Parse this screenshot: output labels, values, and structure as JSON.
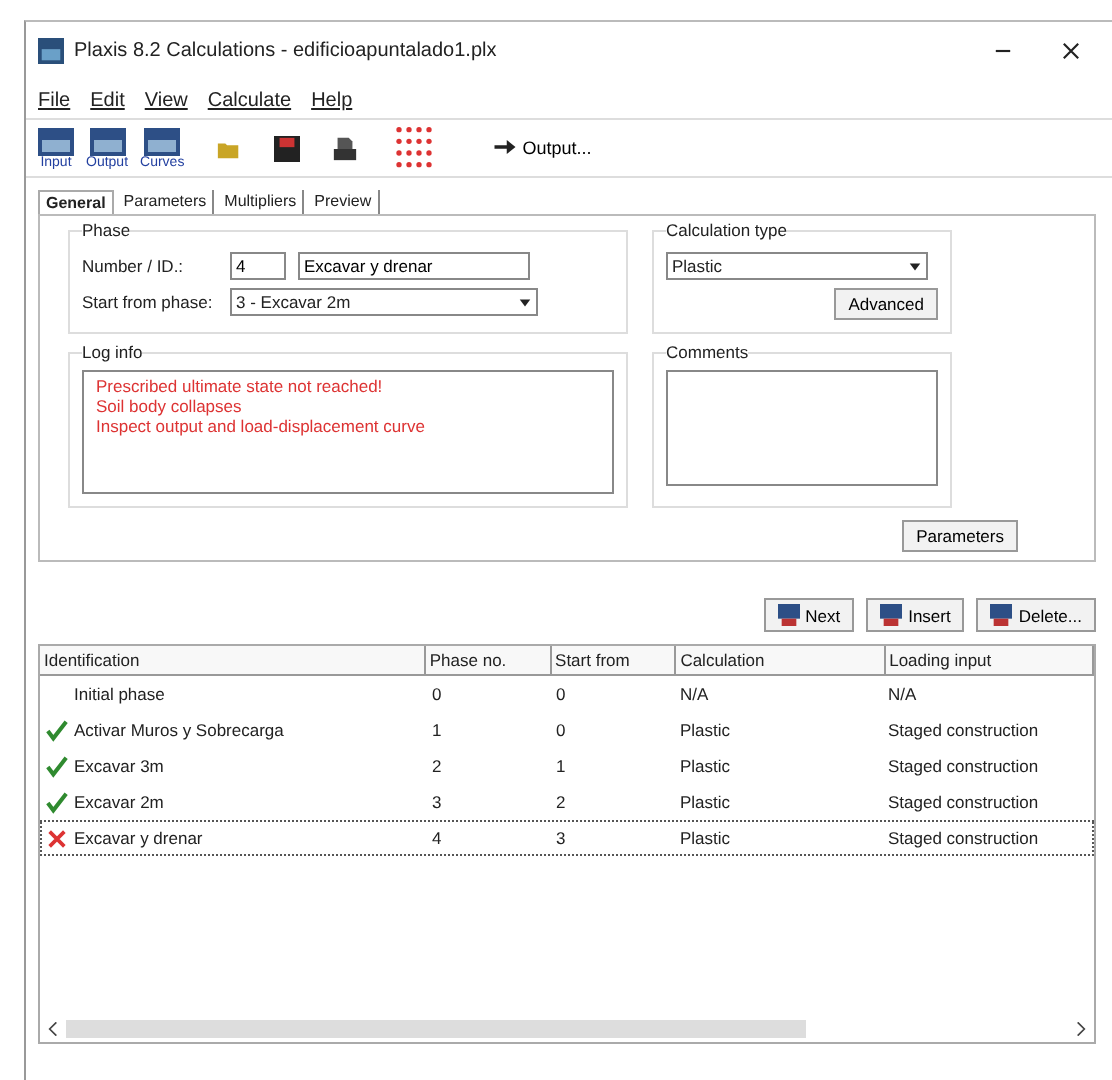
{
  "window": {
    "title": "Plaxis 8.2 Calculations - edificioapuntalado1.plx"
  },
  "menu": [
    "File",
    "Edit",
    "View",
    "Calculate",
    "Help"
  ],
  "toolbar": {
    "buttons": [
      {
        "kind": "module",
        "label": "Input"
      },
      {
        "kind": "module",
        "label": "Output"
      },
      {
        "kind": "module",
        "label": "Curves"
      },
      {
        "kind": "open"
      },
      {
        "kind": "save"
      },
      {
        "kind": "print"
      },
      {
        "kind": "points"
      }
    ],
    "output": "Output..."
  },
  "tabs": [
    {
      "label": "General",
      "selected": true
    },
    {
      "label": "Parameters",
      "selected": false
    },
    {
      "label": "Multipliers",
      "selected": false
    },
    {
      "label": "Preview",
      "selected": false
    }
  ],
  "phase": {
    "title": "Phase",
    "number_label": "Number / ID.:",
    "number": "4",
    "id": "Excavar y drenar",
    "start_label": "Start from phase:",
    "start": "3 - Excavar 2m"
  },
  "calculation_type": {
    "title": "Calculation type",
    "value": "Plastic",
    "advanced": "Advanced"
  },
  "log_info": {
    "title": "Log info",
    "lines": [
      "Prescribed ultimate state not reached!",
      "Soil body collapses",
      "Inspect output and load-displacement curve"
    ]
  },
  "comments": {
    "title": "Comments"
  },
  "parameters_button": "Parameters",
  "actions": [
    "Next",
    "Insert",
    "Delete..."
  ],
  "table": {
    "columns": [
      "Identification",
      "Phase no.",
      "Start from",
      "Calculation",
      "Loading input"
    ],
    "rows": [
      {
        "kind": "plain",
        "selected": false,
        "cells": [
          "Initial phase",
          "0",
          "0",
          "N/A",
          "N/A"
        ]
      },
      {
        "kind": "done",
        "selected": false,
        "cells": [
          "Activar Muros y Sobrecarga",
          "1",
          "0",
          "Plastic",
          "Staged construction"
        ]
      },
      {
        "kind": "done",
        "selected": false,
        "cells": [
          "Excavar 3m",
          "2",
          "1",
          "Plastic",
          "Staged construction"
        ]
      },
      {
        "kind": "done",
        "selected": false,
        "cells": [
          "Excavar 2m",
          "3",
          "2",
          "Plastic",
          "Staged construction"
        ]
      },
      {
        "kind": "failed",
        "selected": true,
        "cells": [
          "Excavar y drenar",
          "4",
          "3",
          "Plastic",
          "Staged construction"
        ]
      }
    ]
  }
}
